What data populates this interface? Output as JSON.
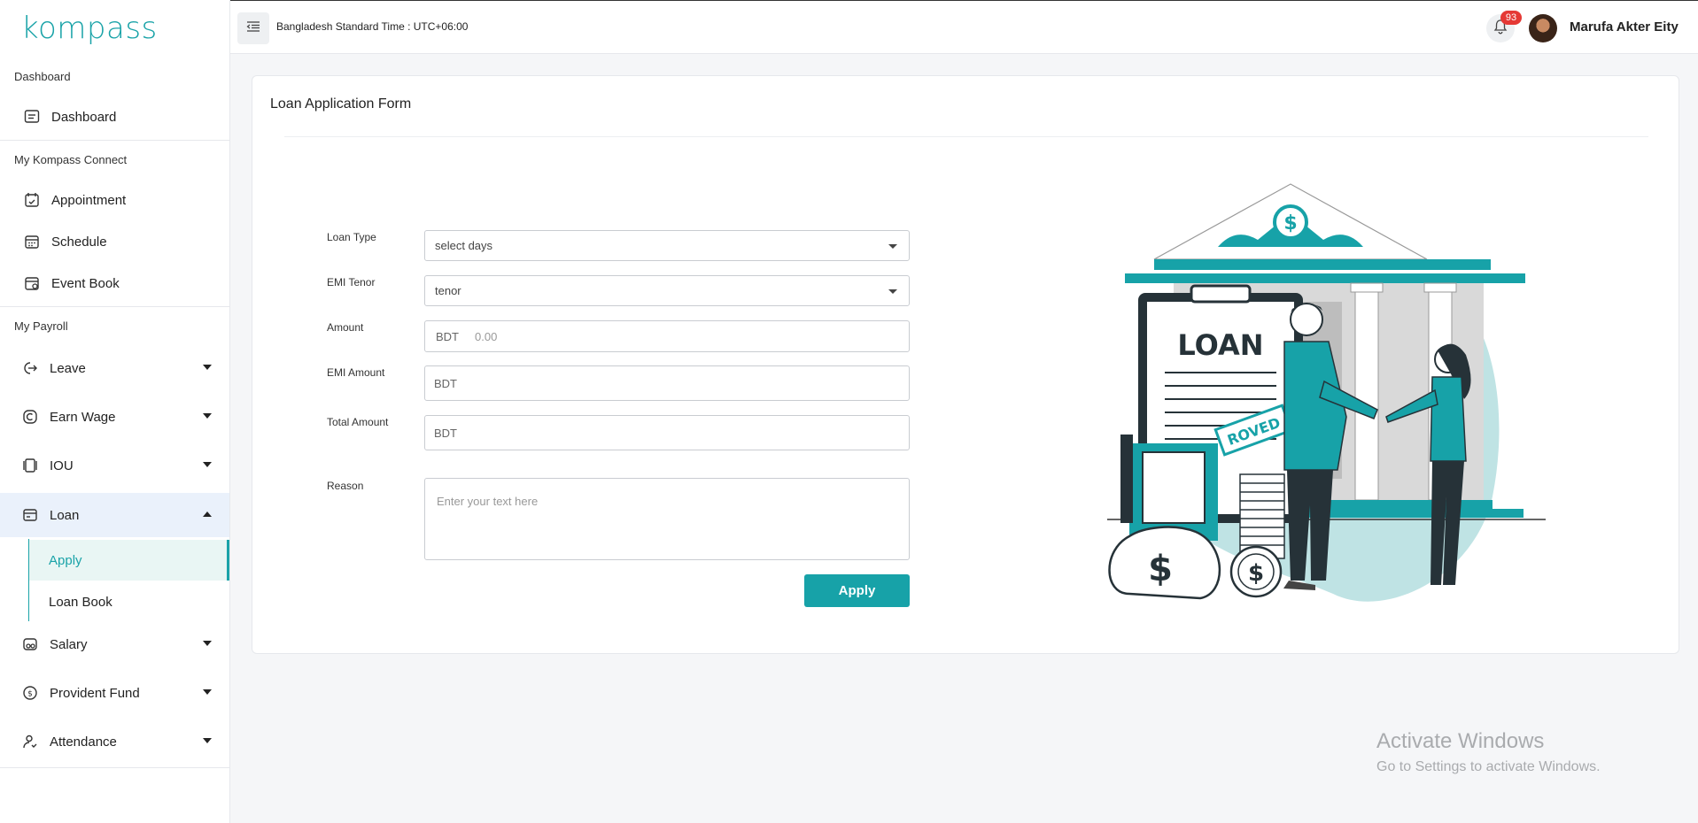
{
  "brand": {
    "logo_text": "kompass",
    "accent": "#1aa3a8"
  },
  "topbar": {
    "timezone": "Bangladesh Standard Time : UTC+06:00",
    "notification_count": "93",
    "user_name": "Marufa Akter Eity"
  },
  "sidebar": {
    "sections": {
      "dashboard": "Dashboard",
      "connect": "My Kompass Connect",
      "payroll": "My Payroll"
    },
    "items": {
      "dashboard": "Dashboard",
      "appointment": "Appointment",
      "schedule": "Schedule",
      "event_book": "Event Book",
      "leave": "Leave",
      "earn_wage": "Earn Wage",
      "iou": "IOU",
      "loan": "Loan",
      "apply": "Apply",
      "loan_book": "Loan Book",
      "salary": "Salary",
      "provident_fund": "Provident Fund",
      "attendance": "Attendance"
    }
  },
  "form": {
    "title": "Loan Application Form",
    "loan_type": {
      "label": "Loan Type",
      "value": "select days"
    },
    "emi_tenor": {
      "label": "EMI Tenor",
      "value": "tenor"
    },
    "amount": {
      "label": "Amount",
      "prefix": "BDT",
      "placeholder": "0.00"
    },
    "emi_amount": {
      "label": "EMI Amount",
      "value": "BDT"
    },
    "total_amount": {
      "label": "Total Amount",
      "value": "BDT"
    },
    "reason": {
      "label": "Reason",
      "placeholder": "Enter your text here"
    },
    "apply_label": "Apply"
  },
  "illustration": {
    "heading": "LOAN",
    "stamp": "ROVED"
  },
  "watermark": {
    "line1": "Activate Windows",
    "line2": "Go to Settings to activate Windows."
  }
}
